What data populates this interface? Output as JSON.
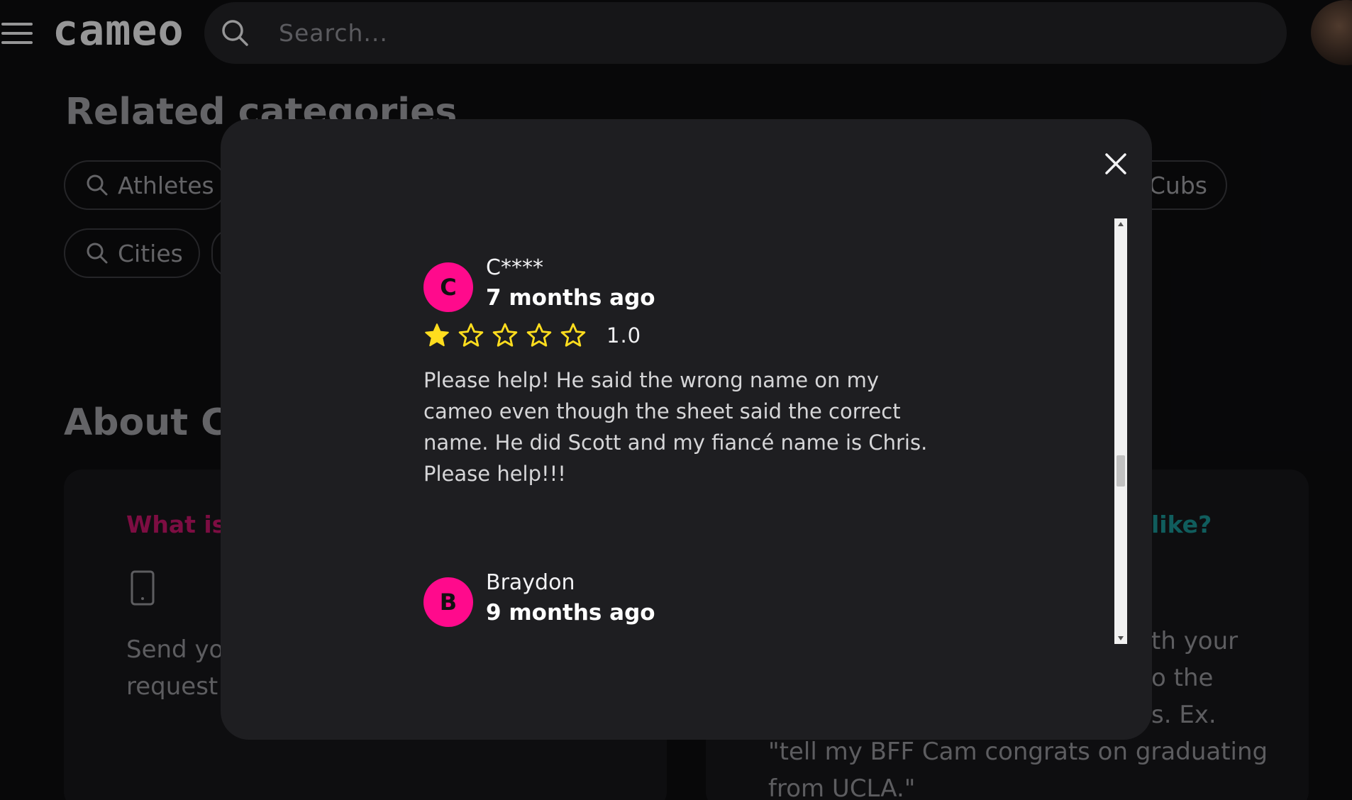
{
  "header": {
    "logo": "cameo",
    "search_placeholder": "Search..."
  },
  "related": {
    "title": "Related categories",
    "chips": [
      "Athletes",
      "Cities",
      "Cubs"
    ]
  },
  "about": {
    "title": "About Ca",
    "left_card_heading": "What is",
    "left_card_text": [
      "Send yo",
      "request"
    ],
    "right_card_heading": "like?",
    "right_card_text": [
      "th your",
      "o the",
      "s. Ex.",
      "\"tell my BFF Cam congrats on graduating",
      "from UCLA.\""
    ]
  },
  "modal": {
    "reviews": [
      {
        "initial": "C",
        "name": "C****",
        "date": "7 months ago",
        "rating": 1,
        "rating_label": "1.0",
        "text": "Please help! He said the wrong name on my cameo even though the sheet said the correct name. He did Scott and my fiancé name is Chris. Please help!!!"
      },
      {
        "initial": "B",
        "name": "Braydon",
        "date": "9 months ago"
      }
    ]
  },
  "colors": {
    "accent_pink": "#ff0a8c",
    "star_yellow": "#ffdd1e",
    "teal": "#1fa6a6"
  }
}
